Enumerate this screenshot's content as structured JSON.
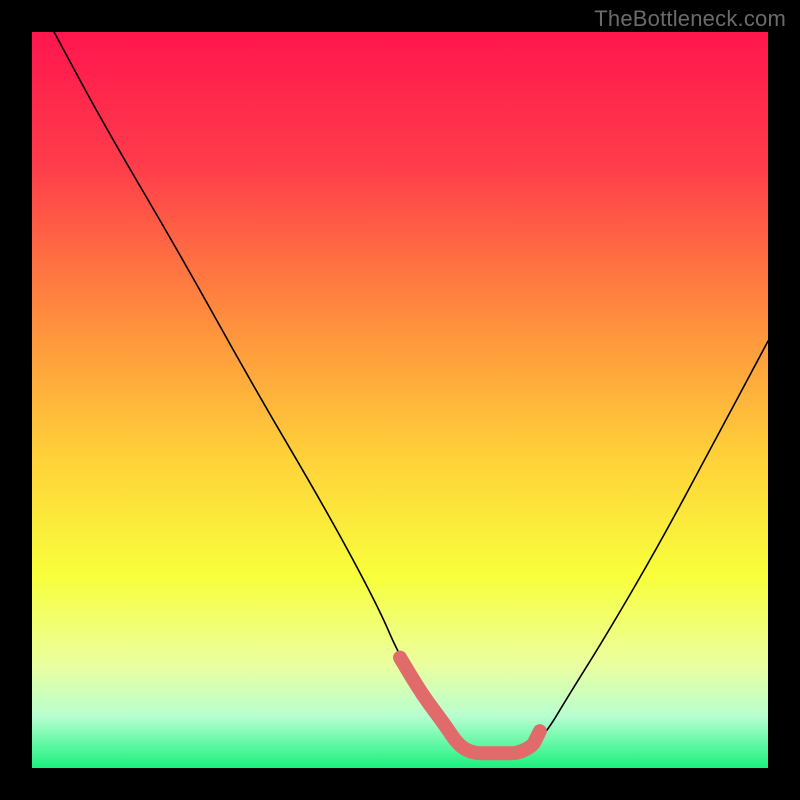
{
  "watermark": {
    "text": "TheBottleneck.com"
  },
  "colors": {
    "frame": "#000000",
    "curve_thin": "#000000",
    "curve_thick": "#e16b6b",
    "gradient_stops": [
      {
        "pct": 0,
        "color": "#ff164e"
      },
      {
        "pct": 18,
        "color": "#ff3c4b"
      },
      {
        "pct": 38,
        "color": "#ff8a3e"
      },
      {
        "pct": 58,
        "color": "#ffd23a"
      },
      {
        "pct": 74,
        "color": "#f8ff3c"
      },
      {
        "pct": 86,
        "color": "#eaffa0"
      },
      {
        "pct": 93,
        "color": "#b7ffd0"
      },
      {
        "pct": 97,
        "color": "#5cf7a1"
      },
      {
        "pct": 100,
        "color": "#1cf07e"
      }
    ]
  },
  "chart_data": {
    "type": "line",
    "title": "",
    "xlabel": "",
    "ylabel": "",
    "xlim": [
      0,
      100
    ],
    "ylim": [
      0,
      100
    ],
    "grid": false,
    "legend": false,
    "series": [
      {
        "name": "bottleneck-curve",
        "x": [
          3,
          10,
          20,
          30,
          40,
          47,
          50,
          55,
          58,
          60,
          63,
          66,
          68,
          70,
          73,
          78,
          85,
          92,
          100
        ],
        "values": [
          100,
          87,
          70,
          52,
          35,
          22,
          15,
          7,
          3,
          2,
          2,
          2,
          3,
          5,
          10,
          18,
          30,
          43,
          58
        ]
      },
      {
        "name": "optimal-zone",
        "x": [
          50,
          53,
          56,
          58,
          60,
          62,
          64,
          66,
          68,
          68.5,
          69
        ],
        "values": [
          15,
          10,
          6,
          3,
          2,
          2,
          2,
          2,
          3,
          4,
          5
        ]
      }
    ],
    "annotations": []
  }
}
